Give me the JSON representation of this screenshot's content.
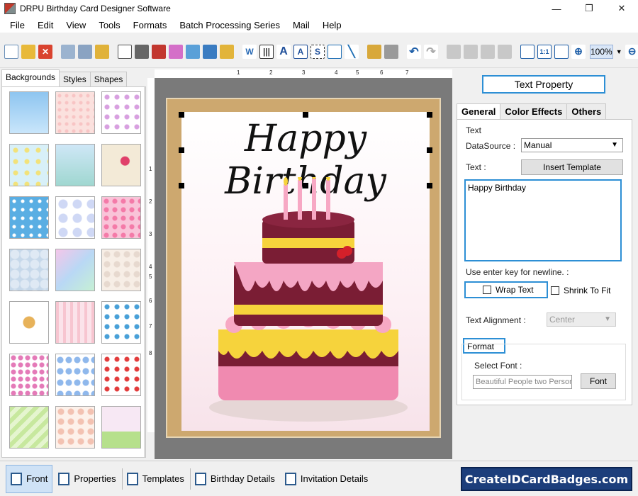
{
  "window": {
    "title": "DRPU Birthday Card Designer Software",
    "min": "—",
    "max": "❐",
    "close": "✕"
  },
  "menu": [
    "File",
    "Edit",
    "View",
    "Tools",
    "Formats",
    "Batch Processing Series",
    "Mail",
    "Help"
  ],
  "toolbar": {
    "zoom": "100%"
  },
  "left_panel": {
    "tabs": [
      "Backgrounds",
      "Styles",
      "Shapes"
    ],
    "active_tab": "Backgrounds"
  },
  "ruler": {
    "top": [
      "1",
      "2",
      "3",
      "4",
      "5",
      "6",
      "7"
    ],
    "left": [
      "1",
      "2",
      "3",
      "4",
      "5",
      "6",
      "7",
      "8"
    ]
  },
  "card": {
    "title": "Happy Birthday"
  },
  "right_panel": {
    "header": "Text Property",
    "tabs": [
      "General",
      "Color Effects",
      "Others"
    ],
    "group_text": "Text",
    "datasource_label": "DataSource :",
    "datasource_value": "Manual",
    "text_label": "Text :",
    "insert_template": "Insert Template",
    "text_value": "Happy Birthday",
    "newline_hint": "Use enter key for newline. :",
    "wrap_text": "Wrap Text",
    "shrink_to_fit": "Shrink To Fit",
    "alignment_label": "Text Alignment :",
    "alignment_value": "Center",
    "format_label": "Format",
    "select_font_label": "Select Font :",
    "font_value": "Beautiful People two Persona",
    "font_button": "Font"
  },
  "bottom": {
    "items": [
      "Front",
      "Properties",
      "Templates",
      "Birthday Details",
      "Invitation Details"
    ],
    "brand": "CreateIDCardBadges.com"
  }
}
